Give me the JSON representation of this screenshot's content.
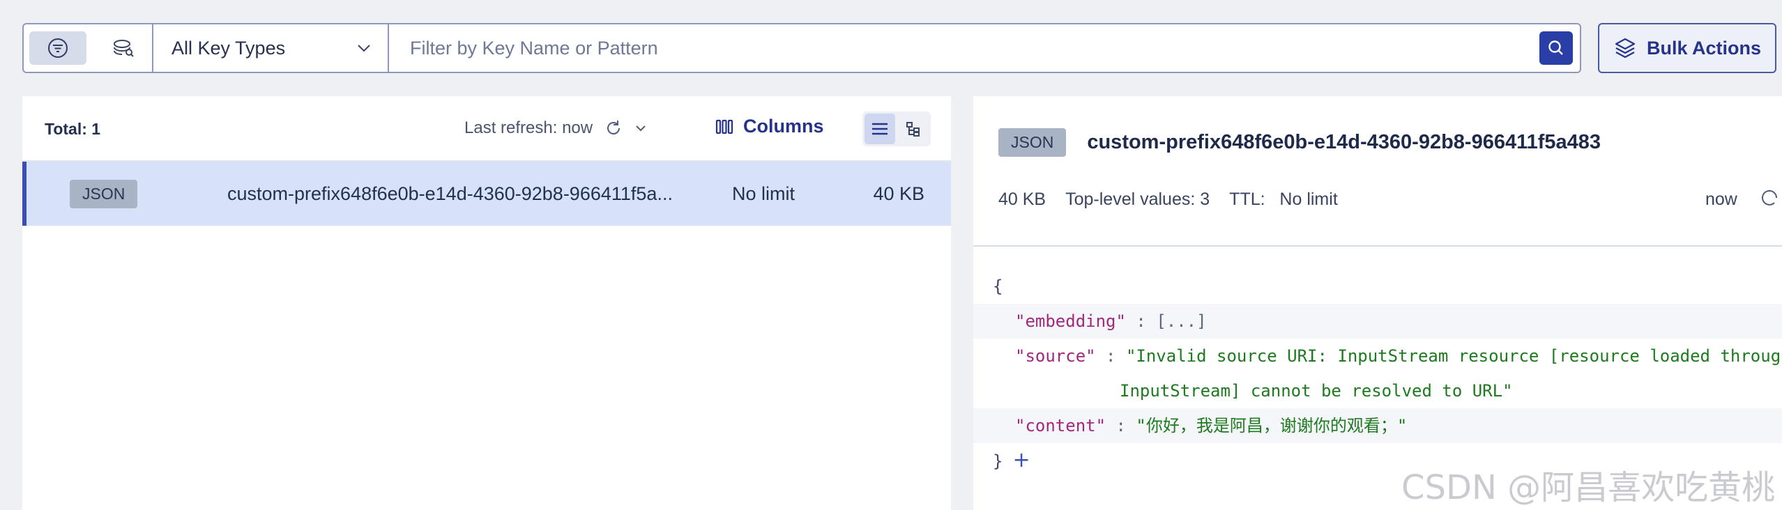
{
  "filter": {
    "type_select": "All Key Types",
    "search_placeholder": "Filter by Key Name or Pattern"
  },
  "bulk_actions_label": "Bulk Actions",
  "list": {
    "total_label": "Total: 1",
    "last_refresh": "Last refresh: now",
    "columns_label": "Columns",
    "rows": [
      {
        "type": "JSON",
        "name": "custom-prefix648f6e0b-e14d-4360-92b8-966411f5a...",
        "ttl": "No limit",
        "size": "40 KB"
      }
    ]
  },
  "detail": {
    "type": "JSON",
    "key_name": "custom-prefix648f6e0b-e14d-4360-92b8-966411f5a483",
    "size": "40 KB",
    "top_level": "Top-level values: 3",
    "ttl_label": "TTL:",
    "ttl_value": "No limit",
    "refreshed": "now",
    "json": {
      "open_brace": "{",
      "close_brace": "}",
      "colon": ":",
      "plus": "+",
      "k1": "\"embedding\"",
      "v1": "[...]",
      "k2": "\"source\"",
      "v2a": "\"Invalid source URI: InputStream resource [resource loaded through",
      "v2b": "InputStream] cannot be resolved to URL\"",
      "k3": "\"content\"",
      "v3": "\"你好，我是阿昌，谢谢你的观看；\""
    }
  },
  "watermark": "CSDN @阿昌喜欢吃黄桃",
  "colors": {
    "accent": "#2a3ea8",
    "selected_row": "#d7e1f7",
    "key": "#a1287e",
    "string": "#1e7a1e"
  }
}
